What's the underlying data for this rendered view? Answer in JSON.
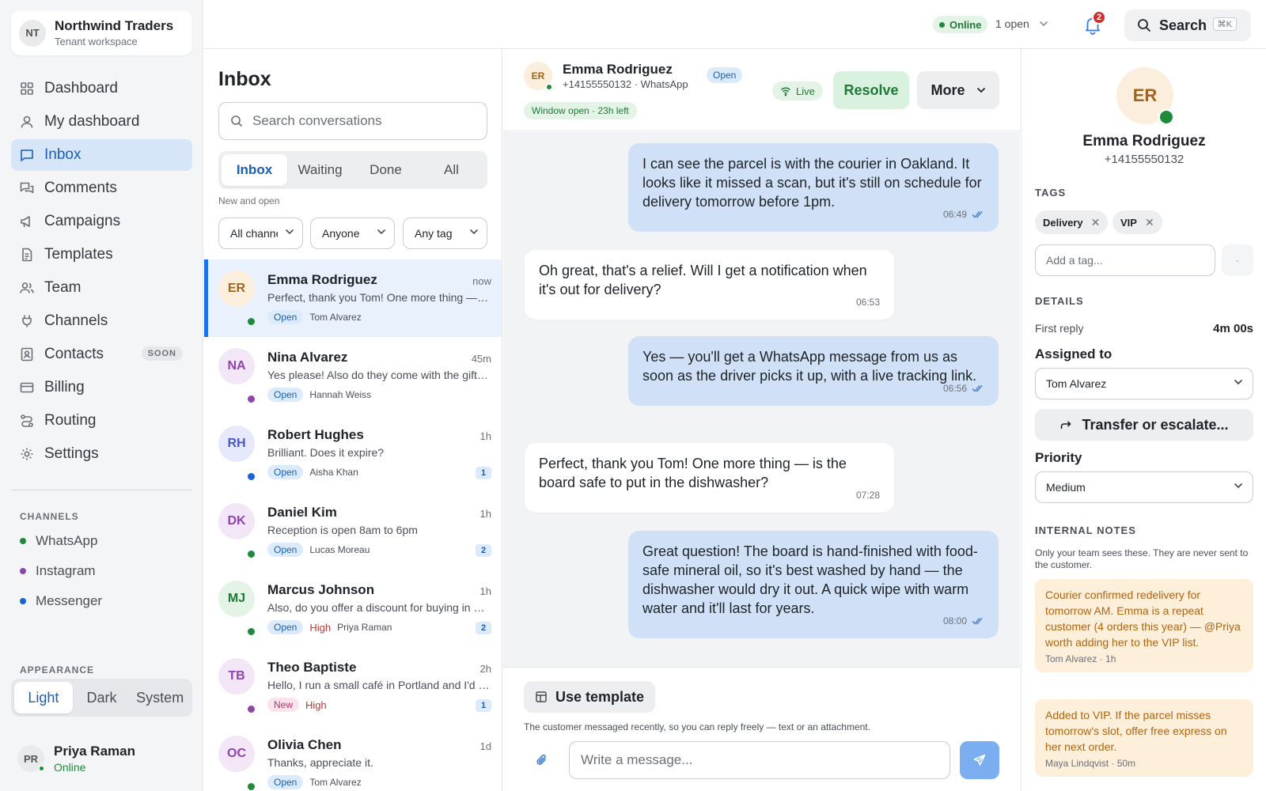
{
  "tenant": {
    "initials": "NT",
    "name": "Northwind Traders",
    "subtitle": "Tenant workspace"
  },
  "nav": [
    {
      "label": "Dashboard",
      "icon": "grid-icon"
    },
    {
      "label": "My dashboard",
      "icon": "user-icon"
    },
    {
      "label": "Inbox",
      "icon": "message-square-icon",
      "active": true
    },
    {
      "label": "Comments",
      "icon": "comments-icon"
    },
    {
      "label": "Campaigns",
      "icon": "megaphone-icon"
    },
    {
      "label": "Templates",
      "icon": "document-icon"
    },
    {
      "label": "Team",
      "icon": "users-icon"
    },
    {
      "label": "Channels",
      "icon": "plug-icon"
    },
    {
      "label": "Contacts",
      "icon": "contact-card-icon",
      "badge": "SOON"
    },
    {
      "label": "Billing",
      "icon": "credit-card-icon"
    },
    {
      "label": "Routing",
      "icon": "routing-icon"
    },
    {
      "label": "Settings",
      "icon": "gear-icon"
    }
  ],
  "channels_section": {
    "title": "CHANNELS",
    "items": [
      {
        "label": "WhatsApp",
        "color": "#1f8a3a"
      },
      {
        "label": "Instagram",
        "color": "#8e44ad"
      },
      {
        "label": "Messenger",
        "color": "#1a63d6"
      }
    ]
  },
  "appearance": {
    "title": "APPEARANCE",
    "options": [
      "Light",
      "Dark",
      "System"
    ],
    "selected": "Light"
  },
  "current_user": {
    "initials": "PR",
    "name": "Priya Raman",
    "status": "Online"
  },
  "topbar": {
    "status": "Online",
    "open_count": "1 open",
    "notifications": "2",
    "search_label": "Search",
    "search_shortcut": "⌘K"
  },
  "inbox": {
    "title": "Inbox",
    "search_placeholder": "Search conversations",
    "tabs": [
      "Inbox",
      "Waiting",
      "Done",
      "All"
    ],
    "active_tab": "Inbox",
    "caption": "New and open",
    "filters": [
      "All channels",
      "Anyone",
      "Any tag"
    ],
    "conversations": [
      {
        "initials": "ER",
        "name": "Emma Rodriguez",
        "time": "now",
        "preview": "Perfect, thank you Tom! One more thing — is the board safe to put in the dishwasher?",
        "status": "Open",
        "priority": "",
        "assignee": "Tom Alvarez",
        "count": "",
        "avatar_bg": "#fbeedd",
        "avatar_fg": "#a0641c",
        "channel_color": "#1f8a3a",
        "selected": true
      },
      {
        "initials": "NA",
        "name": "Nina Alvarez",
        "time": "45m",
        "preview": "Yes please! Also do they come with the gift box?",
        "status": "Open",
        "priority": "",
        "assignee": "Hannah Weiss",
        "count": "",
        "avatar_bg": "#f3e6f7",
        "avatar_fg": "#8e44ad",
        "channel_color": "#8e44ad"
      },
      {
        "initials": "RH",
        "name": "Robert Hughes",
        "time": "1h",
        "preview": "Brilliant. Does it expire?",
        "status": "Open",
        "priority": "",
        "assignee": "Aisha Khan",
        "count": "1",
        "avatar_bg": "#e6e9fb",
        "avatar_fg": "#4a56c4",
        "channel_color": "#1a63d6"
      },
      {
        "initials": "DK",
        "name": "Daniel Kim",
        "time": "1h",
        "preview": "Reception is open 8am to 6pm",
        "status": "Open",
        "priority": "",
        "assignee": "Lucas Moreau",
        "count": "2",
        "avatar_bg": "#f3e6f7",
        "avatar_fg": "#8e44ad",
        "channel_color": "#1f8a3a"
      },
      {
        "initials": "MJ",
        "name": "Marcus Johnson",
        "time": "1h",
        "preview": "Also, do you offer a discount for buying in bulk?",
        "status": "Open",
        "priority": "High",
        "assignee": "Priya Raman",
        "count": "2",
        "avatar_bg": "#e3f4e7",
        "avatar_fg": "#1f7a36",
        "channel_color": "#1f8a3a"
      },
      {
        "initials": "TB",
        "name": "Theo Baptiste",
        "time": "2h",
        "preview": "Hello, I run a small café in Portland and I'd love to stock your boards",
        "status": "New",
        "priority": "High",
        "assignee": "",
        "count": "1",
        "avatar_bg": "#f3e6f7",
        "avatar_fg": "#8e44ad",
        "channel_color": "#8e44ad"
      },
      {
        "initials": "OC",
        "name": "Olivia Chen",
        "time": "1d",
        "preview": "Thanks, appreciate it.",
        "status": "Open",
        "priority": "",
        "assignee": "Tom Alvarez",
        "count": "",
        "avatar_bg": "#f3e6f7",
        "avatar_fg": "#8e44ad",
        "channel_color": "#1f8a3a"
      }
    ]
  },
  "chat": {
    "contact_initials": "ER",
    "contact_name": "Emma Rodriguez",
    "contact_sub": "+14155550132 · WhatsApp",
    "status": "Open",
    "window": "Window open · 23h left",
    "live_label": "Live",
    "resolve_label": "Resolve",
    "more_label": "More",
    "messages": [
      {
        "dir": "out",
        "text": "I can see the parcel is with the courier in Oakland. It looks like it missed a scan, but it's still on schedule for delivery tomorrow before 1pm.",
        "time": "06:49"
      },
      {
        "dir": "in",
        "text": "Oh great, that's a relief. Will I get a notification when it's out for delivery?",
        "time": "06:53"
      },
      {
        "dir": "out",
        "text": "Yes — you'll get a WhatsApp message from us as soon as the driver picks it up, with a live tracking link.",
        "time": "06:56"
      },
      {
        "dir": "in",
        "text": "Perfect, thank you Tom! One more thing — is the board safe to put in the dishwasher?",
        "time": "07:28"
      },
      {
        "dir": "out",
        "text": "Great question! The board is hand-finished with food-safe mineral oil, so it's best washed by hand — the dishwasher would dry it out. A quick wipe with warm water and it'll last for years.",
        "time": "08:00"
      }
    ],
    "template_label": "Use template",
    "composer_hint": "The customer messaged recently, so you can reply freely — text or an attachment.",
    "composer_placeholder": "Write a message..."
  },
  "details": {
    "initials": "ER",
    "name": "Emma Rodriguez",
    "phone": "+14155550132",
    "tags_title": "TAGS",
    "tags": [
      "Delivery",
      "VIP"
    ],
    "tag_placeholder": "Add a tag...",
    "details_title": "DETAILS",
    "first_reply_label": "First reply",
    "first_reply_value": "4m 00s",
    "assigned_label": "Assigned to",
    "assigned_value": "Tom Alvarez",
    "transfer_label": "Transfer or escalate...",
    "priority_label": "Priority",
    "priority_value": "Medium",
    "notes_title": "INTERNAL NOTES",
    "notes_hint": "Only your team sees these. They are never sent to the customer.",
    "notes": [
      {
        "text": "Courier confirmed redelivery for tomorrow AM. Emma is a repeat customer (4 orders this year) — @Priya worth adding her to the VIP list.",
        "by": "Tom Alvarez · 1h"
      },
      {
        "text": "Added to VIP. If the parcel misses tomorrow's slot, offer free express on her next order.",
        "by": "Maya Lindqvist · 50m"
      }
    ]
  }
}
